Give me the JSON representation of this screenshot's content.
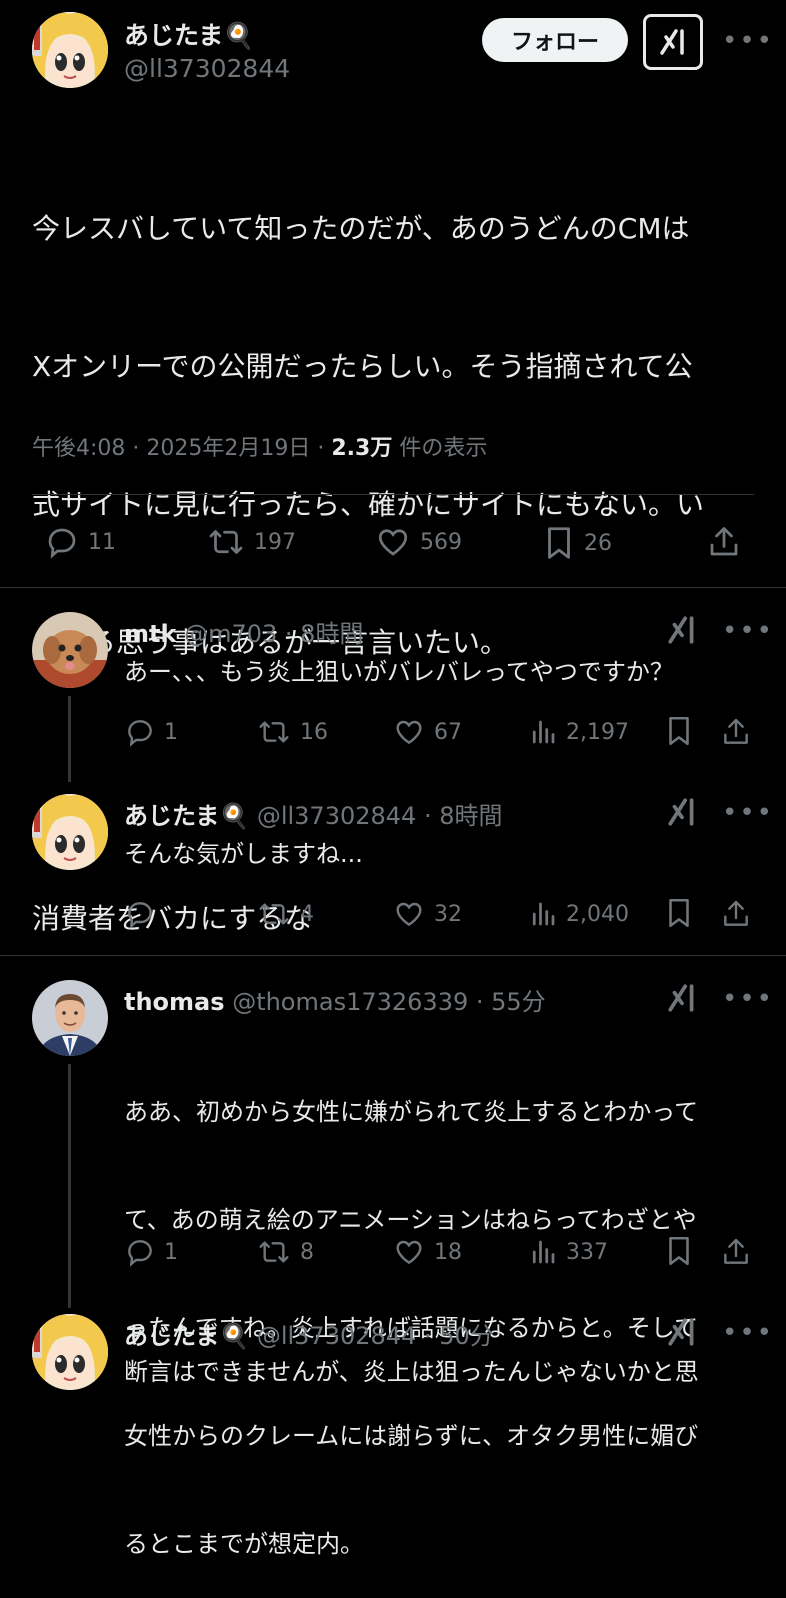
{
  "main_post": {
    "author": "あじたま🍳",
    "handle": "@ll37302844",
    "follow_label": "フォロー",
    "text_lines": [
      "今レスバしていて知ったのだが、あのうどんのCMは",
      "Xオンリーでの公開だったらしい。そう指摘されて公",
      "式サイトに見に行ったら、確かにサイトにもない。い",
      "ろいろ思う事はあるが一言言いたい。",
      "",
      "消費者をバカにするな"
    ],
    "time": "午後4:08 · 2025年2月19日 · ",
    "views_count": "2.3万",
    "views_label": " 件の表示",
    "replies": "11",
    "reposts": "197",
    "likes": "569",
    "bookmarks": "26"
  },
  "replies": [
    {
      "name": "mtk",
      "handle": "@m703",
      "time": " · 8時間",
      "text": "あー、、、もう炎上狙いがバレバレってやつですか？",
      "replies": "1",
      "reposts": "16",
      "likes": "67",
      "views": "2,197"
    },
    {
      "name": "あじたま🍳",
      "handle": "@ll37302844",
      "time": " · 8時間",
      "text": "そんな気がしますね...",
      "replies": "",
      "reposts": "4",
      "likes": "32",
      "views": "2,040"
    },
    {
      "name": "thomas",
      "handle": "@thomas17326339",
      "time": " · 55分",
      "text_lines": [
        "ああ、初めから女性に嫌がられて炎上するとわかって",
        "て、あの萌え絵のアニメーションはねらってわざとや",
        "ったんですね。炎上すれば話題になるからと。そして",
        "女性からのクレームには謝らずに、オタク男性に媚び",
        "るとこまでが想定内。"
      ],
      "replies": "1",
      "reposts": "8",
      "likes": "18",
      "views": "337"
    },
    {
      "name": "あじたま🍳",
      "handle": "@ll37302844",
      "time": " · 50分",
      "text": "断言はできませんが、炎上は狙ったんじゃないかと思"
    }
  ],
  "colors": {
    "background": "#000000",
    "text": "#e7e9ea",
    "muted": "#71767b",
    "divider": "#2f3336"
  }
}
